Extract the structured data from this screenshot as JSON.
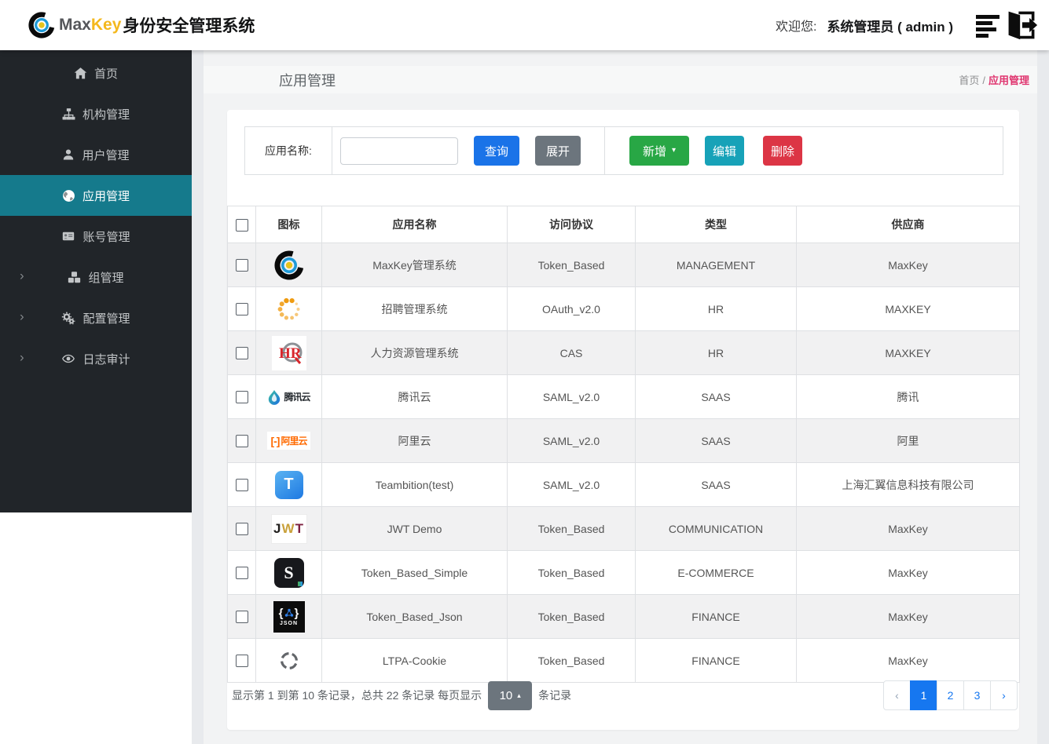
{
  "header": {
    "brand_max": "Max",
    "brand_key": "Key",
    "brand_suffix": "身份安全管理系统",
    "welcome_label": "欢迎您:",
    "username": "系统管理员 ( admin )"
  },
  "sidebar": {
    "items": [
      {
        "id": "home",
        "label": "首页",
        "icon": "home-icon",
        "active": false,
        "has_children": false
      },
      {
        "id": "org",
        "label": "机构管理",
        "icon": "sitemap-icon",
        "active": false,
        "has_children": false
      },
      {
        "id": "user",
        "label": "用户管理",
        "icon": "user-icon",
        "active": false,
        "has_children": false
      },
      {
        "id": "app",
        "label": "应用管理",
        "icon": "globe-icon",
        "active": true,
        "has_children": false
      },
      {
        "id": "account",
        "label": "账号管理",
        "icon": "id-card-icon",
        "active": false,
        "has_children": false
      },
      {
        "id": "group",
        "label": "组管理",
        "icon": "cubes-icon",
        "active": false,
        "has_children": true
      },
      {
        "id": "config",
        "label": "配置管理",
        "icon": "gears-icon",
        "active": false,
        "has_children": true
      },
      {
        "id": "audit",
        "label": "日志审计",
        "icon": "eye-icon",
        "active": false,
        "has_children": true
      }
    ]
  },
  "page": {
    "title": "应用管理",
    "breadcrumb": {
      "home": "首页",
      "sep": "/",
      "current": "应用管理"
    }
  },
  "toolbar": {
    "search_label": "应用名称:",
    "search_value": "",
    "query_label": "查询",
    "expand_label": "展开",
    "add_label": "新增",
    "edit_label": "编辑",
    "delete_label": "删除"
  },
  "table": {
    "columns": [
      "图标",
      "应用名称",
      "访问协议",
      "类型",
      "供应商"
    ],
    "rows": [
      {
        "icon": "maxkey-logo-icon",
        "name": "MaxKey管理系统",
        "protocol": "Token_Based",
        "category": "MANAGEMENT",
        "vendor": "MaxKey"
      },
      {
        "icon": "loading-spinner-icon",
        "name": "招聘管理系统",
        "protocol": "OAuth_v2.0",
        "category": "HR",
        "vendor": "MAXKEY"
      },
      {
        "icon": "hr-logo-icon",
        "name": "人力资源管理系统",
        "protocol": "CAS",
        "category": "HR",
        "vendor": "MAXKEY"
      },
      {
        "icon": "tencent-cloud-icon",
        "name": "腾讯云",
        "protocol": "SAML_v2.0",
        "category": "SAAS",
        "vendor": "腾讯"
      },
      {
        "icon": "aliyun-logo-icon",
        "name": "阿里云",
        "protocol": "SAML_v2.0",
        "category": "SAAS",
        "vendor": "阿里"
      },
      {
        "icon": "teambition-icon",
        "name": "Teambition(test)",
        "protocol": "SAML_v2.0",
        "category": "SAAS",
        "vendor": "上海汇翼信息科技有限公司"
      },
      {
        "icon": "jwt-logo-icon",
        "name": "JWT Demo",
        "protocol": "Token_Based",
        "category": "COMMUNICATION",
        "vendor": "MaxKey"
      },
      {
        "icon": "s-letter-tile-icon",
        "name": "Token_Based_Simple",
        "protocol": "Token_Based",
        "category": "E-COMMERCE",
        "vendor": "MaxKey"
      },
      {
        "icon": "json-logo-icon",
        "name": "Token_Based_Json",
        "protocol": "Token_Based",
        "category": "FINANCE",
        "vendor": "MaxKey"
      },
      {
        "icon": "crosshair-icon",
        "name": "LTPA-Cookie",
        "protocol": "Token_Based",
        "category": "FINANCE",
        "vendor": "MaxKey"
      }
    ]
  },
  "pagination": {
    "summary_prefix": "显示第 1 到第 10 条记录，总共 22 条记录 每页显示",
    "page_size": "10",
    "summary_suffix": "条记录",
    "pages": [
      "1",
      "2",
      "3"
    ],
    "active_page": "1",
    "prev": "‹",
    "next": "›"
  },
  "icons": {
    "caret_down": "▾",
    "caret_up": "▴",
    "chevron_right": "›",
    "tencent_logo_text": "腾讯云",
    "aliyun_bracket": "[-]",
    "aliyun_logo_text": "阿里云",
    "teambition_letter": "T",
    "jwt_letters": [
      "J",
      "W",
      "T"
    ],
    "simple_letter": "S",
    "json_brace_open": "{",
    "json_brace_close": "}",
    "json_label": "JSON"
  },
  "colors": {
    "sidebar_bg": "#212529",
    "sidebar_active": "#157a8c",
    "primary_blue": "#1a73e8",
    "secondary_gray": "#6c757d",
    "success_green": "#28a745",
    "info_teal": "#17a2b8",
    "danger_red": "#dc3545",
    "breadcrumb_pink": "#e0356f",
    "brand_yellow": "#f4b81d",
    "pagination_blue": "#1677f0"
  }
}
